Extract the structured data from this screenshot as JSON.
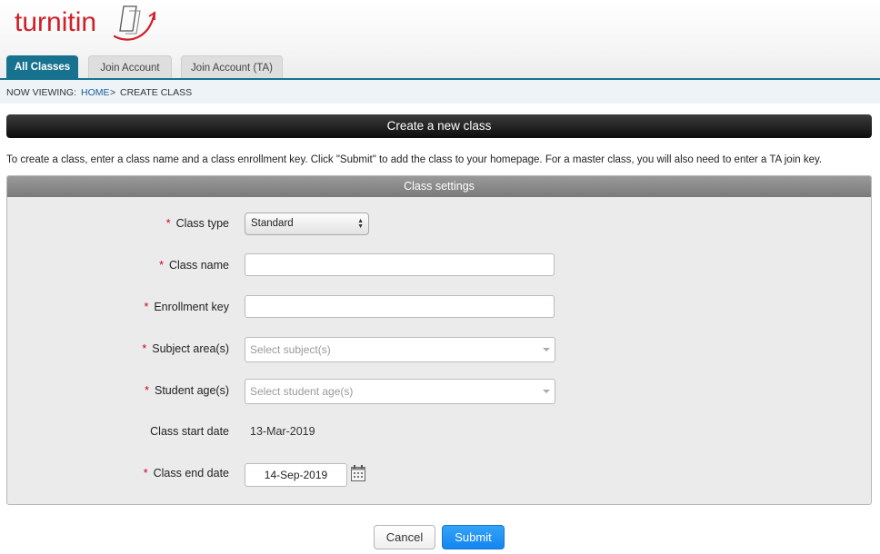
{
  "brand": {
    "logo_text": "turnitin",
    "accent_color": "#cf2027",
    "primary_blue": "#17728f"
  },
  "tabs": [
    {
      "label": "All Classes",
      "active": true
    },
    {
      "label": "Join Account",
      "active": false
    },
    {
      "label": "Join Account (TA)",
      "active": false
    }
  ],
  "breadcrumb": {
    "prefix": "NOW VIEWING:",
    "home": "HOME",
    "separator": ">",
    "current": "CREATE CLASS"
  },
  "page": {
    "title": "Create a new class",
    "intro": "To create a class, enter a class name and a class enrollment key. Click \"Submit\" to add the class to your homepage. For a master class, you will also need to enter a TA join key."
  },
  "form": {
    "section_title": "Class settings",
    "required_marker": "*",
    "class_type": {
      "label": "Class type",
      "value": "Standard"
    },
    "class_name": {
      "label": "Class name",
      "value": ""
    },
    "enrollment_key": {
      "label": "Enrollment key",
      "value": ""
    },
    "subject_area": {
      "label": "Subject area(s)",
      "placeholder": "Select subject(s)"
    },
    "student_age": {
      "label": "Student age(s)",
      "placeholder": "Select student age(s)"
    },
    "start_date": {
      "label": "Class start date",
      "value": "13-Mar-2019"
    },
    "end_date": {
      "label": "Class end date",
      "value": "14-Sep-2019"
    }
  },
  "actions": {
    "cancel_label": "Cancel",
    "submit_label": "Submit"
  },
  "icons": {
    "calendar": "calendar-icon",
    "select_arrows": "updown-arrows-icon",
    "dropdown": "chevron-down-icon"
  }
}
